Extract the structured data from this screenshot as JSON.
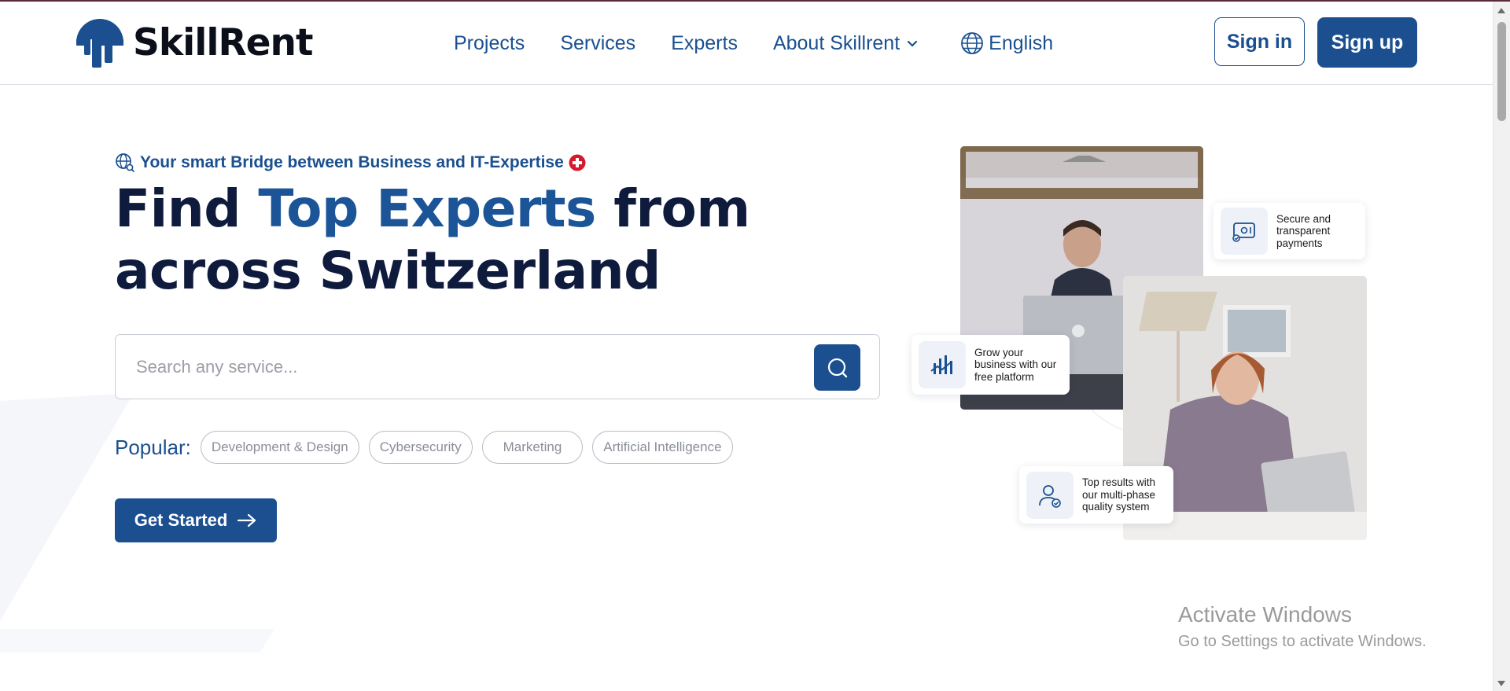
{
  "header": {
    "logo_text": "SkillRent",
    "nav": [
      {
        "label": "Projects"
      },
      {
        "label": "Services"
      },
      {
        "label": "Experts"
      },
      {
        "label": "About Skillrent"
      }
    ],
    "language": "English",
    "sign_in": "Sign in",
    "sign_up": "Sign up"
  },
  "hero": {
    "tagline": "Your smart Bridge between Business and IT-Expertise",
    "title_prefix": "Find ",
    "title_accent": "Top Experts",
    "title_suffix": " from across Switzerland",
    "search_placeholder": "Search any service...",
    "popular_label": "Popular:",
    "popular_tags": [
      "Development & Design",
      "Cybersecurity",
      "Marketing",
      "Artificial Intelligence"
    ],
    "cta": "Get Started"
  },
  "feature_cards": [
    {
      "text": "Secure and transparent payments",
      "icon": "payment-icon"
    },
    {
      "text": "Grow your business with our free platform",
      "icon": "growth-chart-icon"
    },
    {
      "text": "Top results with our multi-phase quality system",
      "icon": "verified-user-icon"
    }
  ],
  "watermark": {
    "title": "Activate Windows",
    "subtitle": "Go to Settings to activate Windows."
  },
  "colors": {
    "primary": "#1b4f8f",
    "accent_text": "#1c5597",
    "heading": "#0f1b3d",
    "swiss_red": "#d7192d"
  }
}
